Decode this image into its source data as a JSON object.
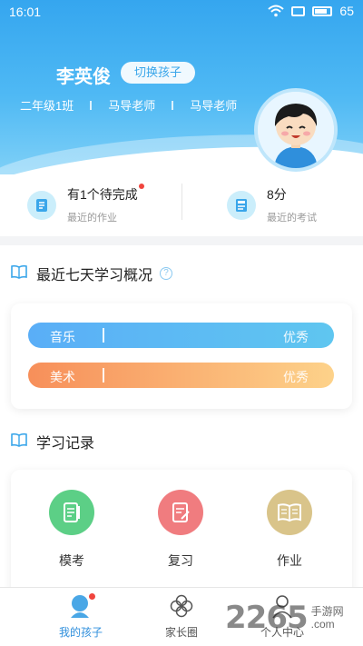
{
  "status_bar": {
    "time": "16:01",
    "battery": "65"
  },
  "header": {
    "child_name": "李英俊",
    "switch_label": "切换孩子",
    "info": [
      "二年级1班",
      "马导老师",
      "马导老师"
    ]
  },
  "summary": {
    "homework": {
      "title": "有1个待完成",
      "subtitle": "最近的作业"
    },
    "exam": {
      "title": "8分",
      "subtitle": "最近的考试"
    }
  },
  "overview": {
    "title": "最近七天学习概况",
    "help": "?",
    "bars": [
      {
        "subject": "音乐",
        "grade": "优秀"
      },
      {
        "subject": "美术",
        "grade": "优秀"
      }
    ]
  },
  "records": {
    "title": "学习记录",
    "items": [
      {
        "label": "模考",
        "color": "#5ccf86"
      },
      {
        "label": "复习",
        "color": "#f07c7f"
      },
      {
        "label": "作业",
        "color": "#d9c48a"
      }
    ]
  },
  "bottom_nav": [
    {
      "label": "我的孩子",
      "active": true
    },
    {
      "label": "家长圈",
      "active": false
    },
    {
      "label": "个人中心",
      "active": false
    }
  ],
  "watermark": {
    "number": "2265",
    "suffix": "手游网",
    "domain": ".com"
  },
  "colors": {
    "primary": "#35a6ef",
    "accent_red": "#f0443d"
  }
}
